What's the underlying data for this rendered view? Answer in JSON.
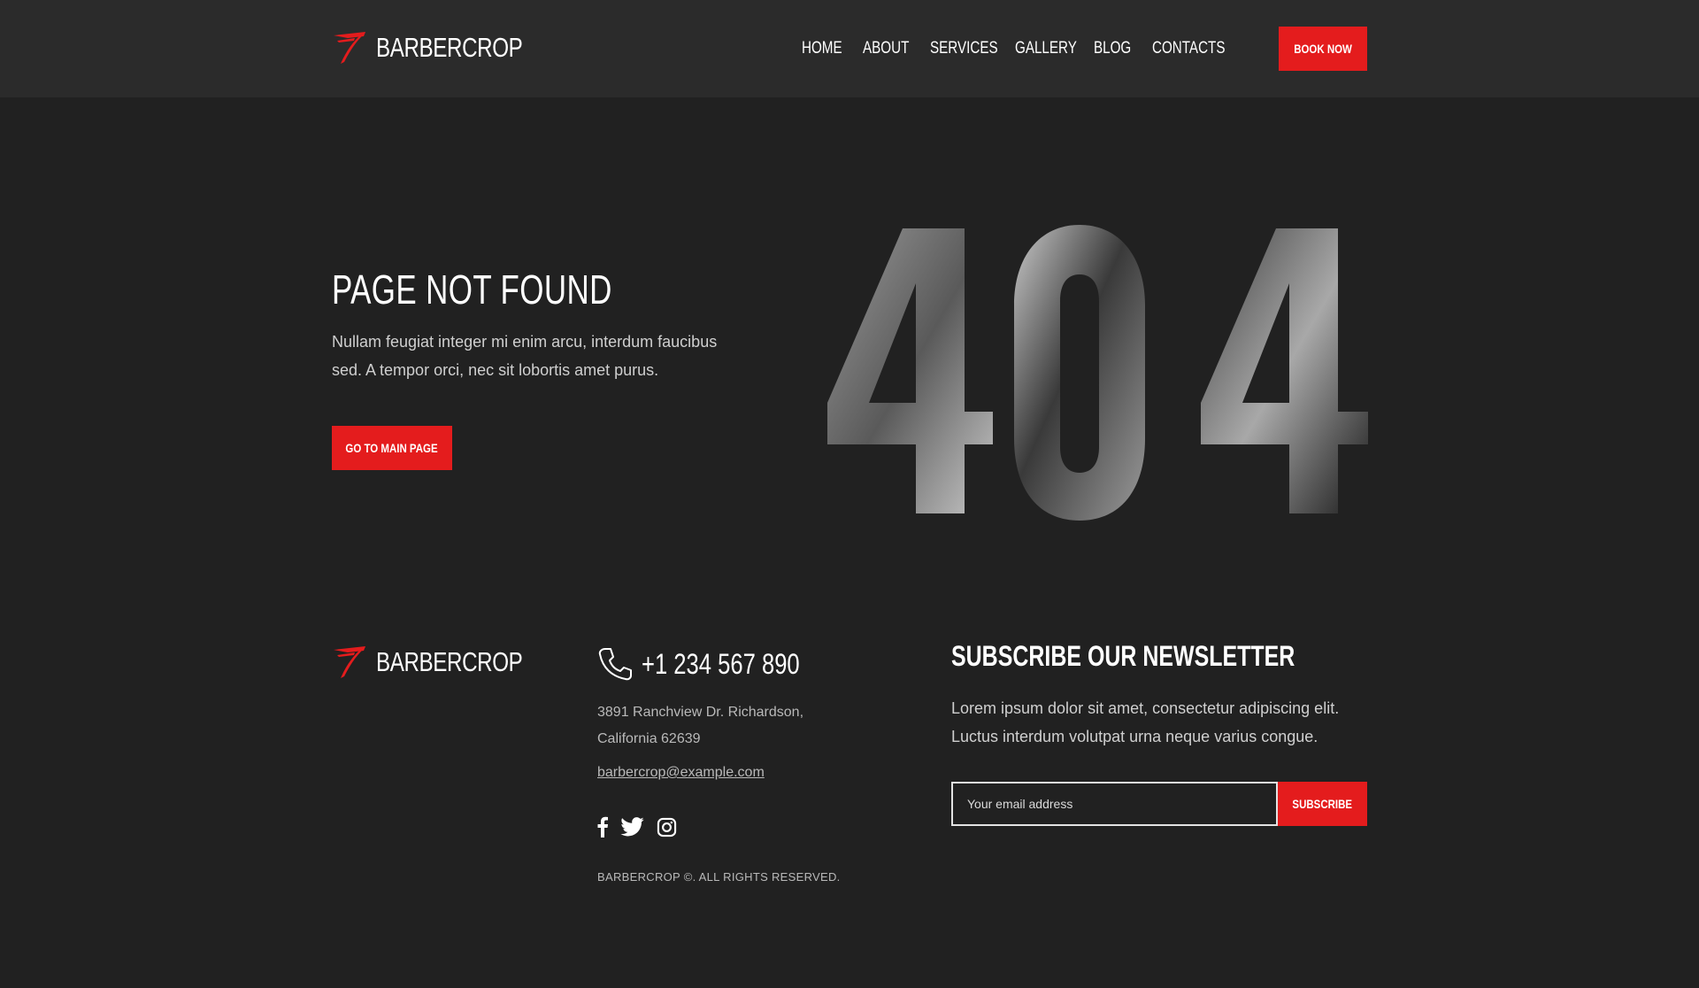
{
  "brand": {
    "name": "BARBERCROP",
    "accent": "#e41c1d"
  },
  "nav": {
    "items": [
      {
        "label": "HOME"
      },
      {
        "label": "ABOUT"
      },
      {
        "label": "SERVICES"
      },
      {
        "label": "GALLERY"
      },
      {
        "label": "BLOG"
      },
      {
        "label": "CONTACTS"
      }
    ],
    "book_label": "BOOK NOW"
  },
  "hero": {
    "title": "PAGE NOT FOUND",
    "text": "Nullam feugiat integer mi enim arcu, interdum faucibus sed. A tempor orci, nec sit lobortis amet purus.",
    "button_label": "GO TO MAIN PAGE",
    "error_code": "404"
  },
  "footer": {
    "phone": "+1 234 567 890",
    "address_line1": "3891 Ranchview Dr. Richardson,",
    "address_line2": "California 62639",
    "email": "barbercrop@example.com",
    "socials": [
      "facebook-icon",
      "twitter-icon",
      "instagram-icon"
    ],
    "copyright": "BARBERCROP ©. ALL RIGHTS RESERVED.",
    "newsletter": {
      "title": "SUBSCRIBE OUR NEWSLETTER",
      "text": "Lorem ipsum dolor sit amet, consectetur adipiscing elit. Luctus interdum volutpat urna neque varius congue.",
      "placeholder": "Your email address",
      "button_label": "SUBSCRIBE"
    }
  }
}
